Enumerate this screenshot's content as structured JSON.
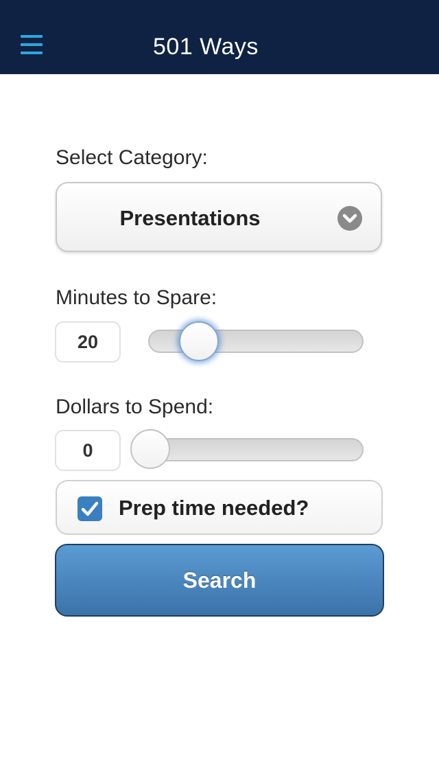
{
  "header": {
    "title": "501 Ways",
    "menu_icon": "hamburger-menu-icon"
  },
  "category": {
    "label": "Select Category:",
    "selected": "Presentations",
    "icon": "chevron-down-circle-icon"
  },
  "minutes": {
    "label": "Minutes to Spare:",
    "value": "20",
    "slider_fraction": 0.25
  },
  "dollars": {
    "label": "Dollars to Spend:",
    "value": "0",
    "slider_fraction": 0.0
  },
  "prep": {
    "label": "Prep time needed?",
    "checked": true
  },
  "search": {
    "label": "Search"
  },
  "colors": {
    "header_bg": "#0f2244",
    "menu_icon": "#2ea6e0",
    "button_primary": "#4a86bd",
    "checkbox": "#3a7fc0"
  }
}
